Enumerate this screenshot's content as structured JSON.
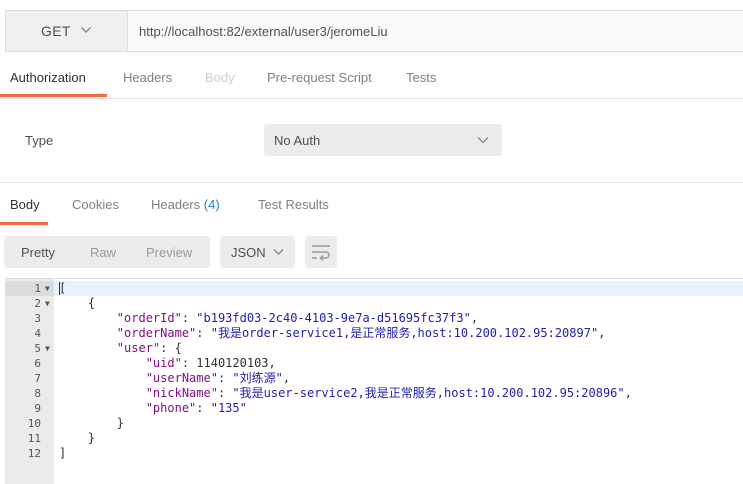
{
  "request": {
    "method": "GET",
    "url": "http://localhost:82/external/user3/jeromeLiu"
  },
  "request_tabs": [
    "Authorization",
    "Headers",
    "Body",
    "Pre-request Script",
    "Tests"
  ],
  "auth": {
    "type_label": "Type",
    "type_value": "No Auth"
  },
  "response_tabs": {
    "body": "Body",
    "cookies": "Cookies",
    "headers": "Headers",
    "headers_count": "(4)",
    "test_results": "Test Results"
  },
  "toolbar": {
    "views": [
      "Pretty",
      "Raw",
      "Preview"
    ],
    "format": "JSON"
  },
  "code_lines": [
    {
      "ln": "1",
      "fold": true
    },
    {
      "ln": "2",
      "fold": true
    },
    {
      "ln": "3",
      "indent": "        ",
      "key": "\"orderId\"",
      "value": "\"b193fd03-2c40-4103-9e7a-d51695fc37f3\"",
      "after": ","
    },
    {
      "ln": "4",
      "indent": "        ",
      "key": "\"orderName\"",
      "value": "\"我是order-service1,是正常服务,host:10.200.102.95:20897\"",
      "after": ","
    },
    {
      "ln": "5",
      "fold": true,
      "indent": "        ",
      "key": "\"user\"",
      "after": ": {"
    },
    {
      "ln": "6",
      "indent": "            ",
      "key": "\"uid\"",
      "number": "1140120103",
      "after": ","
    },
    {
      "ln": "7",
      "indent": "            ",
      "key": "\"userName\"",
      "value": "\"刘练源\"",
      "after": ","
    },
    {
      "ln": "8",
      "indent": "            ",
      "key": "\"nickName\"",
      "value": "\"我是user-service2,我是正常服务,host:10.200.102.95:20896\"",
      "after": ","
    },
    {
      "ln": "9",
      "indent": "            ",
      "key": "\"phone\"",
      "value": "\"135\""
    },
    {
      "ln": "10",
      "text": "        }"
    },
    {
      "ln": "11",
      "text": "    }"
    },
    {
      "ln": "12",
      "text": "]"
    }
  ]
}
